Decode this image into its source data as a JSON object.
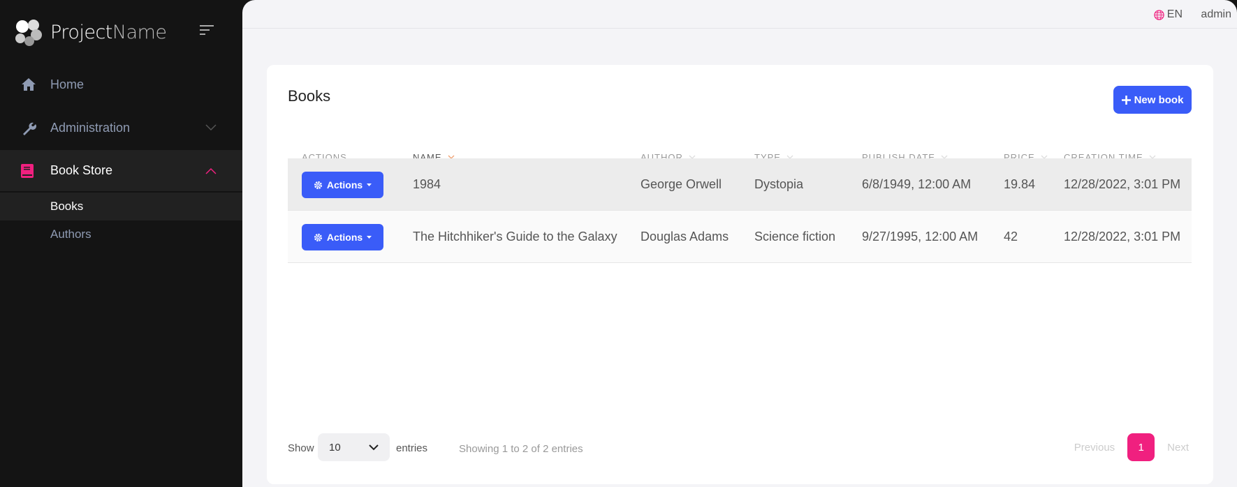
{
  "brand": {
    "name_bold": "Project",
    "name_thin": "Name"
  },
  "sidebar": {
    "items": [
      {
        "label": "Home",
        "icon": "home-icon"
      },
      {
        "label": "Administration",
        "icon": "wrench-icon"
      },
      {
        "label": "Book Store",
        "icon": "book-icon",
        "expanded": true,
        "children": [
          {
            "label": "Books",
            "active": true
          },
          {
            "label": "Authors"
          }
        ]
      }
    ]
  },
  "topbar": {
    "language": "EN",
    "user": "admin"
  },
  "page": {
    "title": "Books",
    "new_button": "New book"
  },
  "table": {
    "columns": [
      "ACTIONS",
      "NAME",
      "AUTHOR",
      "TYPE",
      "PUBLISH DATE",
      "PRICE",
      "CREATION TIME"
    ],
    "action_label": "Actions",
    "rows": [
      [
        "1984",
        "George Orwell",
        "Dystopia",
        "6/8/1949, 12:00 AM",
        "19.84",
        "12/28/2022, 3:01 PM"
      ],
      [
        "The Hitchhiker's Guide to the Galaxy",
        "Douglas Adams",
        "Science fiction",
        "9/27/1995, 12:00 AM",
        "42",
        "12/28/2022, 3:01 PM"
      ]
    ]
  },
  "footer": {
    "show": "Show",
    "page_size": "10",
    "entries": "entries",
    "info": "Showing 1 to 2 of 2 entries",
    "previous": "Previous",
    "current_page": "1",
    "next": "Next"
  },
  "colors": {
    "accent": "#f0207f",
    "primary": "#3a5cf8",
    "sidebar": "#141414"
  }
}
